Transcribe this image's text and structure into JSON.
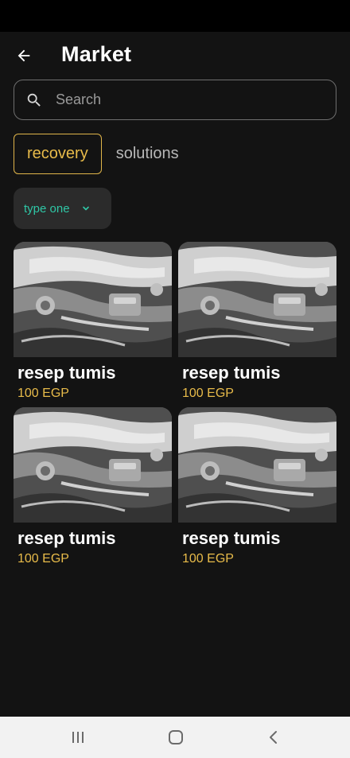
{
  "header": {
    "title": "Market",
    "back_icon": "arrow-left-icon"
  },
  "search": {
    "placeholder": "Search",
    "value": "",
    "icon": "search-icon"
  },
  "tabs": [
    {
      "label": "recovery",
      "active": true
    },
    {
      "label": "solutions",
      "active": false
    }
  ],
  "filter": {
    "selected": "type one",
    "icon": "chevron-down-icon"
  },
  "products": [
    {
      "name": "resep tumis",
      "price": "100 EGP",
      "image": "engine-photo"
    },
    {
      "name": "resep tumis",
      "price": "100 EGP",
      "image": "engine-photo"
    },
    {
      "name": "resep tumis",
      "price": "100 EGP",
      "image": "engine-photo"
    },
    {
      "name": "resep tumis",
      "price": "100 EGP",
      "image": "engine-photo"
    }
  ],
  "navigation": {
    "buttons": [
      "recent-apps-icon",
      "home-icon",
      "back-icon"
    ]
  },
  "colors": {
    "background": "#131313",
    "accent": "#e8bb4a",
    "filter_text": "#2fc7a6",
    "nav_bar": "#f2f2f2"
  }
}
